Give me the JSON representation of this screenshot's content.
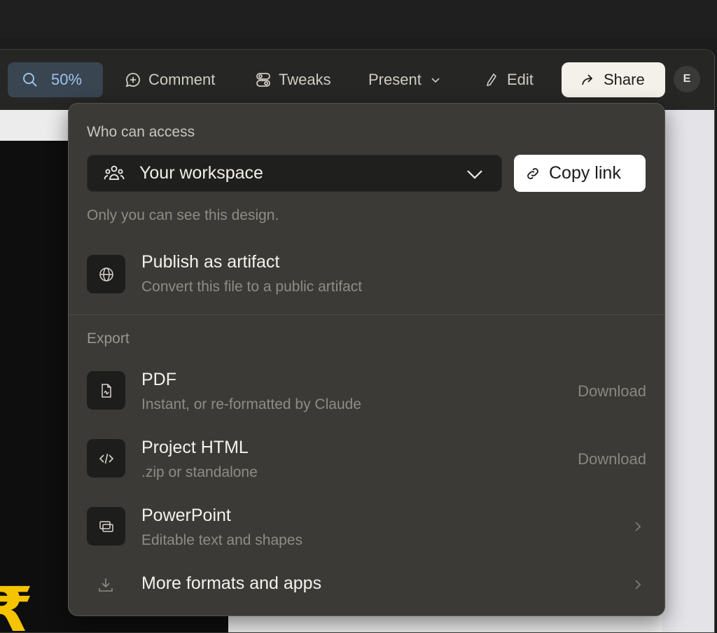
{
  "toolbar": {
    "zoom_label": "50%",
    "comment_label": "Comment",
    "tweaks_label": "Tweaks",
    "present_label": "Present",
    "edit_label": "Edit",
    "share_label": "Share",
    "avatar_initial": "E"
  },
  "share_panel": {
    "access_heading": "Who can access",
    "access_select_value": "Your workspace",
    "copy_link_label": "Copy link",
    "access_hint": "Only you can see this design.",
    "publish": {
      "title": "Publish as artifact",
      "subtitle": "Convert this file to a public artifact"
    },
    "export_heading": "Export",
    "export_items": [
      {
        "title": "PDF",
        "subtitle": "Instant, or re-formatted by Claude",
        "action": "Download"
      },
      {
        "title": "Project HTML",
        "subtitle": ".zip or standalone",
        "action": "Download"
      },
      {
        "title": "PowerPoint",
        "subtitle": "Editable text and shapes"
      },
      {
        "title": "More formats and apps"
      }
    ]
  },
  "colors": {
    "panel_bg": "#3b3a36",
    "zoom_accent": "#9fc2ea",
    "canvas_glyph": "#f5c400"
  }
}
